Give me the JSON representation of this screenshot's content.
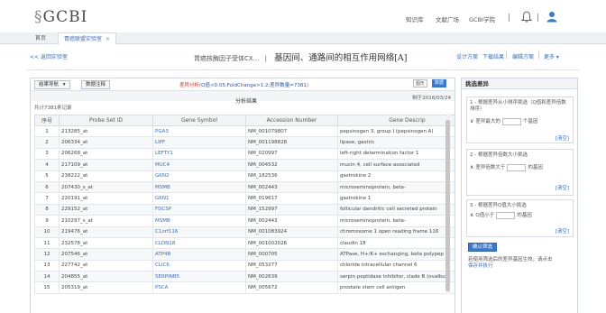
{
  "header": {
    "logo_prefix": "§",
    "logo_text": "GCBI",
    "nav": [
      "知识库",
      "文献广场",
      "GCBI学院"
    ],
    "accent": "#3a6db4"
  },
  "tabs": [
    {
      "label": "首页"
    },
    {
      "label": "胃癌联盟实验室",
      "close": "×"
    }
  ],
  "toolbar": {
    "back": "<< 返回实验室",
    "title_small": "胃癌核酶因子受体CX...",
    "title_sep": "|",
    "title_big": "基因间、通路间的相互作用网络[A]",
    "right_links": [
      "设计方案",
      "下载结果",
      "编辑方案",
      "更多 ▾"
    ]
  },
  "results": {
    "nav_button": "结果导航",
    "nav_caret": "▾",
    "hint_button": "数据注释",
    "filter_prefix": "差异分析(",
    "filter_cond": "Q值<0.05;FoldChange>1.2;差异数量=7381",
    "filter_suffix": ")",
    "view_options": [
      "图形",
      "数据"
    ],
    "count_label": "共计7381条记录",
    "table_title": "分析结果",
    "date_label": "制于2016/03/24"
  },
  "table": {
    "columns": [
      "序号",
      "Probe Set ID",
      "Gene Symbol",
      "Accession Number",
      "Gene Descrip"
    ],
    "rows": [
      [
        "1",
        "213285_at",
        "PGA3",
        "NM_001079807",
        "pepsinogen 3, group I (pepsinogen A)"
      ],
      [
        "2",
        "206334_at",
        "LIPF",
        "NM_001198828",
        "lipase, gastric"
      ],
      [
        "3",
        "206268_at",
        "LEFTY1",
        "NM_020997",
        "left-right determination factor 1"
      ],
      [
        "4",
        "217109_at",
        "MUC4",
        "NM_004532",
        "mucin 4, cell surface associated"
      ],
      [
        "5",
        "238222_at",
        "GKN2",
        "NM_182536",
        "gastrokine 2"
      ],
      [
        "6",
        "207430_s_at",
        "MSMB",
        "NM_002443",
        "microseminoprotein, beta-"
      ],
      [
        "7",
        "220191_at",
        "GKN1",
        "NM_019617",
        "gastrokine 1"
      ],
      [
        "8",
        "229152_at",
        "FDCSP",
        "NM_152997",
        "follicular dendritic cell secreted protein"
      ],
      [
        "9",
        "210297_s_at",
        "MSMB",
        "NM_002443",
        "microseminoprotein, beta-"
      ],
      [
        "10",
        "219476_at",
        "C1orf116",
        "NM_001083924",
        "chromosome 1 open reading frame 116"
      ],
      [
        "11",
        "232578_at",
        "CLDN18",
        "NM_001002026",
        "claudin 18"
      ],
      [
        "12",
        "207546_at",
        "ATP4B",
        "NM_000705",
        "ATPase, H+/K+ exchanging, beta polypep"
      ],
      [
        "13",
        "227742_at",
        "CLIC6",
        "NM_053277",
        "chloride intracellular channel 6"
      ],
      [
        "14",
        "204855_at",
        "SERPINB5",
        "NM_002639",
        "serpin peptidase inhibitor, clade B (ovalbu"
      ],
      [
        "15",
        "205319_at",
        "PSCA",
        "NM_005672",
        "prostate stem cell antigen"
      ]
    ]
  },
  "sidebar": {
    "title": "挑选差异",
    "filters": [
      {
        "title": "1 - 根据差异从小排序挑选（Q值和差异倍数排序）",
        "pre": "差异最大的",
        "post": "个基因",
        "clear": "[清空]",
        "chev": "∨"
      },
      {
        "title": "2 - 根据差异倍数大小挑选",
        "pre": "差异倍数大于",
        "post": "的基因",
        "clear": "[清空]",
        "chev": "∧"
      },
      {
        "title": "3 - 根据差异Q值大小挑选",
        "pre": "Q值小于",
        "post": "的基因",
        "clear": "[清空]",
        "chev": "∧"
      }
    ],
    "submit": "确认筛选",
    "note_text": "若使用筛选后的差异基因生效，请点击",
    "note_link": "保存并执行"
  }
}
